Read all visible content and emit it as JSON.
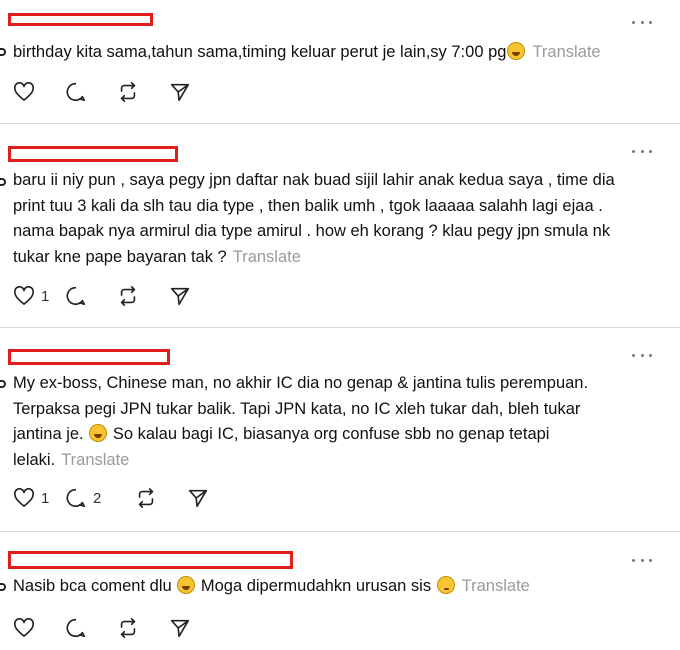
{
  "posts": [
    {
      "text": "birthday kita sama,tahun sama,timing keluar perut je lain,sy 7:00 pg",
      "lines": [],
      "emoji_end": "rolling-laughing-emoji",
      "translate": "Translate",
      "likes": "",
      "comments": ""
    },
    {
      "lines": [
        "baru ii niy pun , saya pegy jpn daftar nak buad sijil lahir anak kedua saya , time dia",
        "print tuu 3 kali da slh tau dia type , then balik umh , tgok laaaaa salahh lagi ejaa .",
        "nama bapak nya armirul dia type amirul . how eh korang ? klau pegy jpn smula nk",
        "tukar kne pape bayaran tak ?"
      ],
      "translate": "Translate",
      "likes": "1",
      "comments": ""
    },
    {
      "lines": [
        "My ex-boss, Chinese man, no akhir IC dia no genap & jantina tulis perempuan.",
        "Terpaksa pegi JPN tukar balik. Tapi JPN kata, no IC xleh tukar dah, bleh tukar",
        "jantina je.",
        "So kalau bagi IC, biasanya org confuse sbb no genap tetapi",
        "lelaki."
      ],
      "translate": "Translate",
      "likes": "1",
      "comments": "2"
    },
    {
      "part1": "Nasib bca coment dlu",
      "part2": "Moga dipermudahkn urusan sis",
      "translate": "Translate",
      "likes": "",
      "comments": ""
    }
  ]
}
